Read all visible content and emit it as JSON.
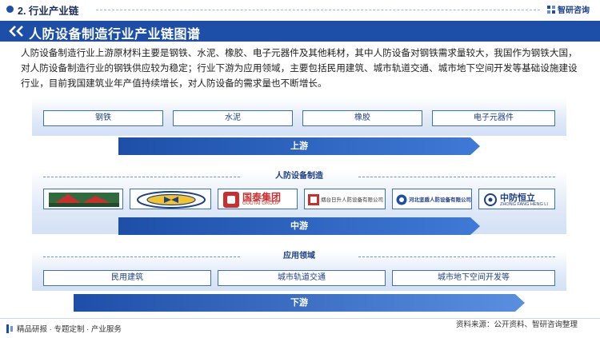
{
  "header": {
    "section_title": "2. 行业产业链",
    "brand_name": "智研咨询"
  },
  "title": "人防设备制造行业产业链图谱",
  "description": "人防设备制造行业上游原材料主要是钢铁、水泥、橡胶、电子元器件及其他耗材，其中人防设备对钢铁需求量较大，我国作为钢铁大国，对人防设备制造行业的钢铁供应较为稳定；行业下游为应用领域，主要包括民用建筑、城市轨道交通、城市地下空间开发等基础设施建设行业，目前我国建筑业年产值持续增长，对人防设备的需求量也不断增长。",
  "upstream": {
    "items": [
      "钢铁",
      "水泥",
      "橡胶",
      "电子元器件"
    ],
    "arrow_label": "上游"
  },
  "midstream": {
    "heading": "人防设备制造",
    "companies": [
      {
        "name": "company-logo-1",
        "text": ""
      },
      {
        "name": "company-logo-2",
        "text": ""
      },
      {
        "name": "company-logo-guotai",
        "text": "国泰集团",
        "sub": "GUOTAI GROUP"
      },
      {
        "name": "company-logo-yantai",
        "text": "烟台日升人防设备有限公司"
      },
      {
        "name": "company-logo-hebei",
        "text": "河北坚盾人防设备有限公司"
      },
      {
        "name": "company-logo-zhongfang",
        "text": "中防恒立",
        "sub": "ZHONG FANG HENG LI"
      }
    ],
    "arrow_label": "中游"
  },
  "downstream": {
    "heading": "应用领域",
    "items": [
      "民用建筑",
      "城市轨道交通",
      "城市地下空间开发等"
    ],
    "arrow_label": "下游"
  },
  "footer": {
    "left_text": "精品研报 · 专题定制 · 产业服务",
    "source": "资料来源：公开资料、智研咨询整理"
  },
  "colors": {
    "primary": "#1d4fa8",
    "arrow_start": "#1d4fa8",
    "arrow_end": "#5a8fe0"
  }
}
